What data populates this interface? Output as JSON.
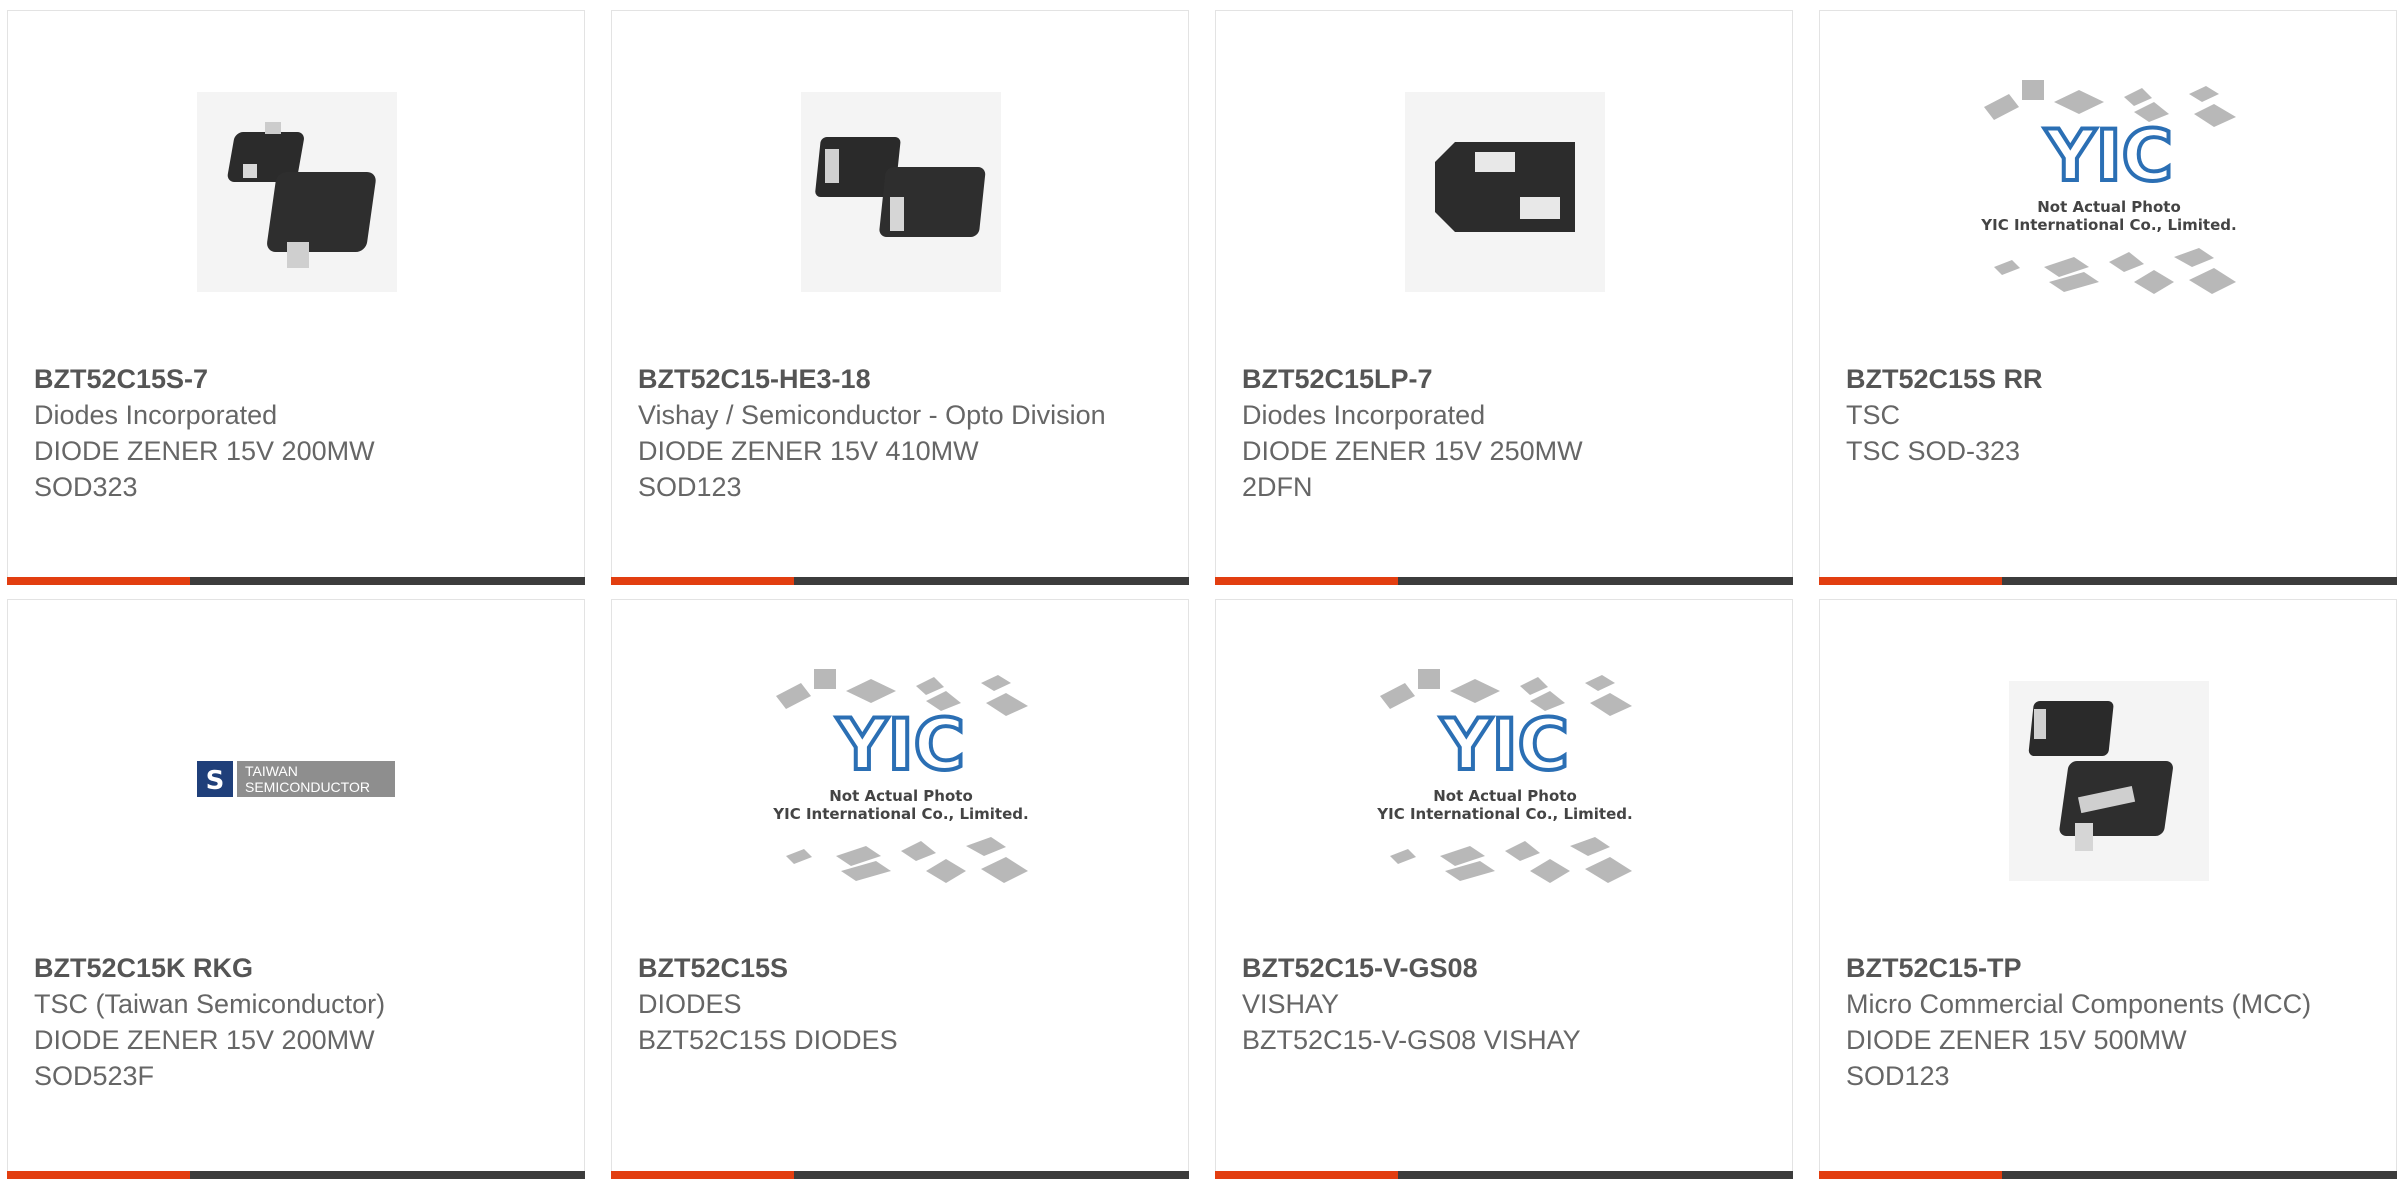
{
  "products": [
    {
      "part": "BZT52C15S-7",
      "maker": "Diodes Incorporated",
      "desc": [
        "DIODE ZENER 15V 200MW",
        "SOD323"
      ],
      "image": "sod323-diode-photo"
    },
    {
      "part": "BZT52C15-HE3-18",
      "maker": "Vishay / Semiconductor - Opto Division",
      "desc": [
        "DIODE ZENER 15V 410MW",
        "SOD123"
      ],
      "image": "sod123-diode-photo"
    },
    {
      "part": "BZT52C15LP-7",
      "maker": "Diodes Incorporated",
      "desc": [
        "DIODE ZENER 15V 250MW",
        "2DFN"
      ],
      "image": "dfn-package-photo"
    },
    {
      "part": "BZT52C15S RR",
      "maker": "TSC",
      "desc": [
        "TSC SOD-323"
      ],
      "image": "yic-placeholder"
    },
    {
      "part": "BZT52C15K RKG",
      "maker": "TSC (Taiwan Semiconductor)",
      "desc": [
        "DIODE ZENER 15V 200MW",
        "SOD523F"
      ],
      "image": "taiwan-semiconductor-logo"
    },
    {
      "part": "BZT52C15S",
      "maker": "DIODES",
      "desc": [
        "BZT52C15S DIODES"
      ],
      "image": "yic-placeholder"
    },
    {
      "part": "BZT52C15-V-GS08",
      "maker": "VISHAY",
      "desc": [
        "BZT52C15-V-GS08 VISHAY"
      ],
      "image": "yic-placeholder"
    },
    {
      "part": "BZT52C15-TP",
      "maker": "Micro Commercial Components (MCC)",
      "desc": [
        "DIODE ZENER 15V 500MW",
        "SOD123"
      ],
      "image": "sod123-diode-photo"
    }
  ],
  "placeholder": {
    "logo": "YIC",
    "line1": "Not Actual Photo",
    "line2": "YIC International Co., Limited."
  },
  "tsc_logo": {
    "line1": "TAIWAN",
    "line2": "SEMICONDUCTOR"
  },
  "colors": {
    "accent": "#e23e10",
    "bar": "#3c3c3c",
    "text": "#666666",
    "title": "#555555"
  }
}
